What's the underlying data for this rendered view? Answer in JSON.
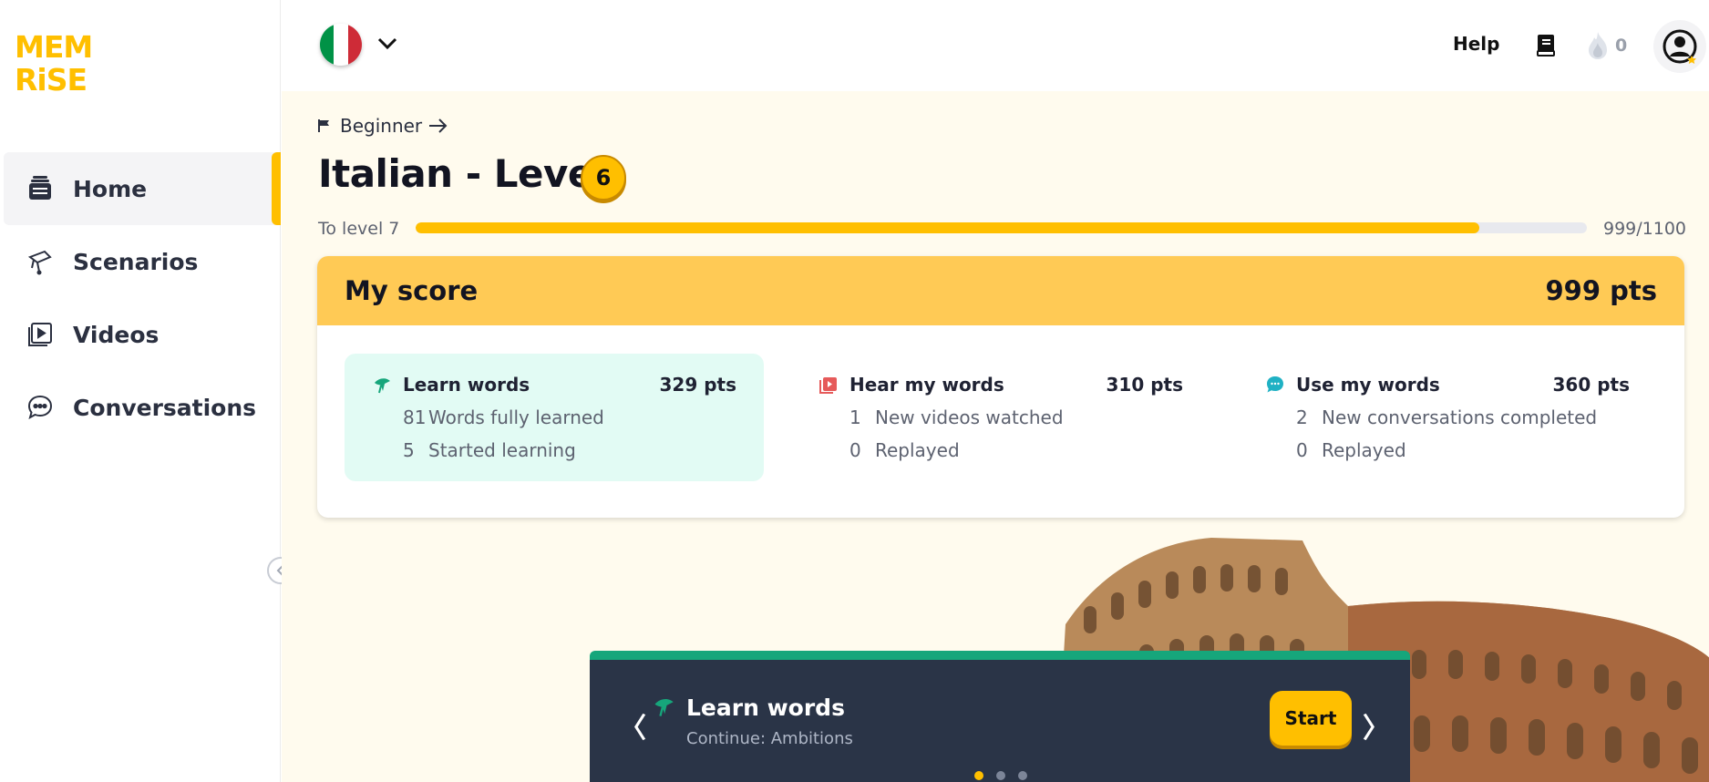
{
  "brand": {
    "logo_line1": "MEM",
    "logo_line2": "RiSE",
    "color": "#ffbf00"
  },
  "sidebar": {
    "items": [
      {
        "label": "Home",
        "icon": "home-stack-icon",
        "active": true
      },
      {
        "label": "Scenarios",
        "icon": "scenarios-icon",
        "active": false
      },
      {
        "label": "Videos",
        "icon": "video-play-icon",
        "active": false
      },
      {
        "label": "Conversations",
        "icon": "chat-bubble-icon",
        "active": false
      }
    ]
  },
  "topbar": {
    "language_flag": "italy-flag",
    "help_label": "Help",
    "streak_count": "0"
  },
  "main": {
    "breadcrumb": "Beginner",
    "title": "Italian - Level",
    "level": "6",
    "progress": {
      "label": "To level 7",
      "current": 999,
      "total": 1100,
      "text": "999/1100"
    },
    "score": {
      "title": "My score",
      "total": "999 pts",
      "columns": [
        {
          "name": "Learn words",
          "pts": "329 pts",
          "icon": "learn-sprout-icon",
          "rows": [
            {
              "n": "81",
              "label": "Words fully learned"
            },
            {
              "n": "5",
              "label": "Started learning"
            }
          ]
        },
        {
          "name": "Hear my words",
          "pts": "310 pts",
          "icon": "video-red-icon",
          "rows": [
            {
              "n": "1",
              "label": "New videos watched"
            },
            {
              "n": "0",
              "label": "Replayed"
            }
          ]
        },
        {
          "name": "Use my words",
          "pts": "360 pts",
          "icon": "chat-teal-icon",
          "rows": [
            {
              "n": "2",
              "label": "New conversations completed"
            },
            {
              "n": "0",
              "label": "Replayed"
            }
          ]
        }
      ]
    },
    "task_card": {
      "title": "Learn words",
      "subtitle": "Continue: Ambitions",
      "start_label": "Start",
      "prev_glyph": "〈",
      "next_glyph": "〉",
      "pages": 3,
      "active_page": 0
    }
  },
  "colors": {
    "accent": "#ffbf00",
    "score_header": "#ffca55",
    "highlight": "#e2fbf4",
    "card_dark": "#2a3447",
    "card_green": "#16a67b"
  }
}
